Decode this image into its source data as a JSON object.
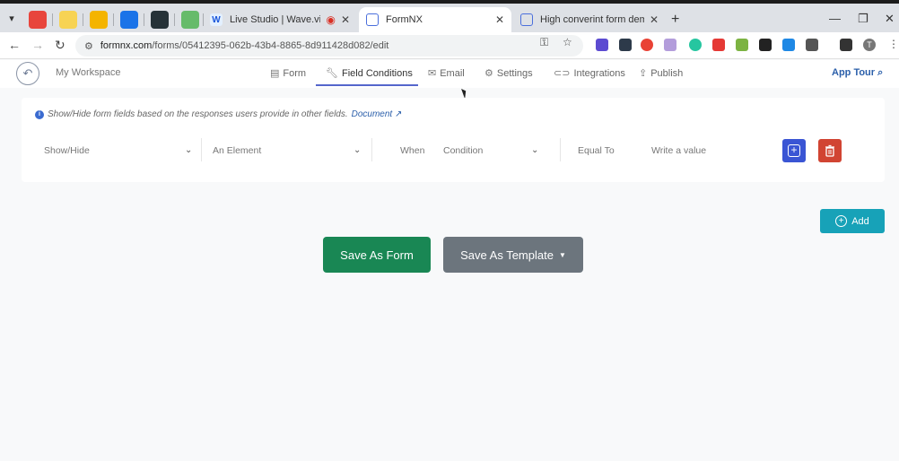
{
  "browser": {
    "tabs": [
      {
        "title": "Live Studio | Wave.video",
        "icon": "wave-video-favicon"
      },
      {
        "title": "FormNX",
        "icon": "formnx-favicon",
        "active": true
      },
      {
        "title": "High converint form demo - Fo",
        "icon": "formnx-favicon"
      }
    ],
    "pinned_icons": [
      "calendar-favicon",
      "pencil-favicon",
      "folder-favicon",
      "bookmark-favicon",
      "s-favicon",
      "leaf-favicon"
    ],
    "url_host": "formnx.com",
    "url_path": "/forms/05412395-062b-43b4-8865-8d911428d082/edit",
    "profile_initial": "T"
  },
  "appnav": {
    "workspace": "My Workspace",
    "items": [
      {
        "label": "Form",
        "icon": "form-icon"
      },
      {
        "label": "Field Conditions",
        "icon": "wrench-icon",
        "active": true
      },
      {
        "label": "Email",
        "icon": "email-icon"
      },
      {
        "label": "Settings",
        "icon": "gear-icon"
      },
      {
        "label": "Integrations",
        "icon": "link-icon"
      },
      {
        "label": "Publish",
        "icon": "publish-icon"
      }
    ],
    "app_tour": "App Tour"
  },
  "panel": {
    "info_text": "Show/Hide form fields based on the responses users provide in other fields.",
    "doc_link": "Document",
    "action_select": "Show/Hide",
    "element_select": "An Element",
    "when_label": "When",
    "condition_select": "Condition",
    "equal_label": "Equal To",
    "value_placeholder": "Write a value"
  },
  "buttons": {
    "add": "Add",
    "save_form": "Save As Form",
    "save_template": "Save As Template"
  },
  "colors": {
    "save_form": "#198754",
    "save_template": "#6c757d",
    "add": "#17a2b8",
    "plus": "#3a55d4",
    "trash": "#d14432",
    "accent": "#5566cc"
  }
}
